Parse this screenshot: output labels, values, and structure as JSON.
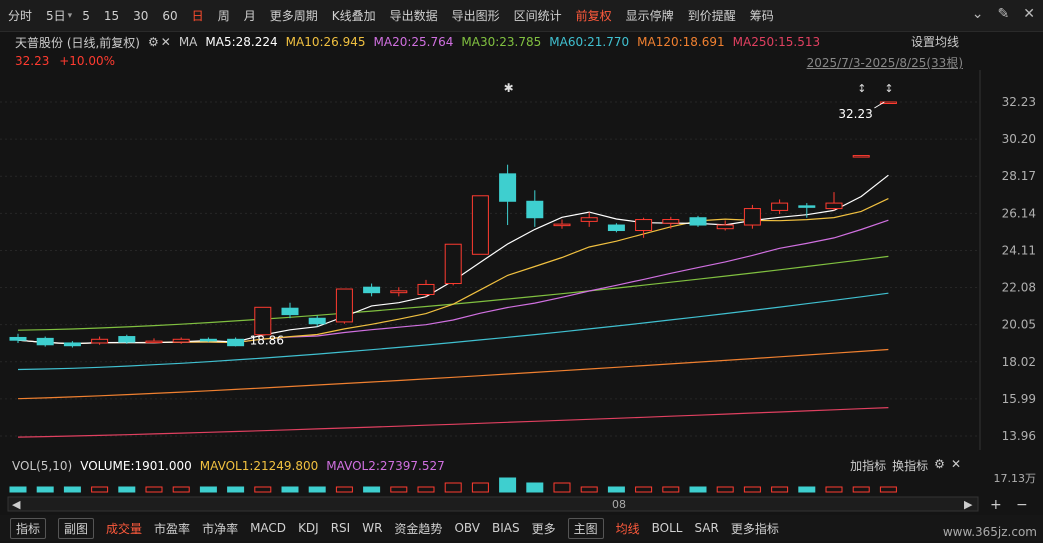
{
  "toolbar": {
    "items": [
      "分时",
      "5日",
      "5",
      "15",
      "30",
      "60",
      "日",
      "周",
      "月",
      "更多周期",
      "K线叠加",
      "导出数据",
      "导出图形",
      "区间统计",
      "前复权",
      "显示停牌",
      "到价提醒",
      "筹码"
    ]
  },
  "info": {
    "name": "天普股份 (日线,前复权)",
    "ma_label": "MA",
    "ma5": "MA5:28.224",
    "ma10": "MA10:26.945",
    "ma20": "MA20:25.764",
    "ma30": "MA30:23.785",
    "ma60": "MA60:21.770",
    "ma120": "MA120:18.691",
    "ma250": "MA250:15.513",
    "setup": "设置均线"
  },
  "price": {
    "value": "32.23",
    "change": "+10.00%"
  },
  "date_range": "2025/7/3-2025/8/25(33根)",
  "chart_data": {
    "type": "candlestick",
    "y_ticks": [
      "32.23",
      "30.20",
      "28.17",
      "26.14",
      "24.11",
      "22.08",
      "20.05",
      "18.02",
      "15.99",
      "13.96"
    ],
    "annotations": {
      "high": "32.23",
      "low": "18.86"
    },
    "x_label": "08",
    "candles": [
      {
        "o": 19.35,
        "c": 19.2,
        "h": 19.55,
        "l": 19.05
      },
      {
        "o": 19.3,
        "c": 18.95,
        "h": 19.4,
        "l": 18.85
      },
      {
        "o": 19.05,
        "c": 18.9,
        "h": 19.15,
        "l": 18.8
      },
      {
        "o": 19.05,
        "c": 19.25,
        "h": 19.4,
        "l": 18.95
      },
      {
        "o": 19.4,
        "c": 19.1,
        "h": 19.5,
        "l": 19.0
      },
      {
        "o": 19.15,
        "c": 19.15,
        "h": 19.3,
        "l": 19.05
      },
      {
        "o": 19.1,
        "c": 19.25,
        "h": 19.35,
        "l": 19.0
      },
      {
        "o": 19.25,
        "c": 19.2,
        "h": 19.35,
        "l": 19.1
      },
      {
        "o": 19.25,
        "c": 18.9,
        "h": 19.35,
        "l": 18.86
      },
      {
        "o": 19.5,
        "c": 21.0,
        "h": 21.0,
        "l": 19.4
      },
      {
        "o": 20.95,
        "c": 20.6,
        "h": 21.25,
        "l": 20.4
      },
      {
        "o": 20.4,
        "c": 20.1,
        "h": 20.55,
        "l": 19.95
      },
      {
        "o": 20.2,
        "c": 22.0,
        "h": 22.0,
        "l": 20.1
      },
      {
        "o": 22.1,
        "c": 21.8,
        "h": 22.3,
        "l": 21.6
      },
      {
        "o": 21.8,
        "c": 21.9,
        "h": 22.1,
        "l": 21.6
      },
      {
        "o": 21.7,
        "c": 22.25,
        "h": 22.5,
        "l": 21.6
      },
      {
        "o": 22.3,
        "c": 24.45,
        "h": 24.45,
        "l": 22.2
      },
      {
        "o": 23.9,
        "c": 27.1,
        "h": 27.1,
        "l": 23.9
      },
      {
        "o": 28.3,
        "c": 26.8,
        "h": 28.8,
        "l": 25.5
      },
      {
        "o": 26.8,
        "c": 25.9,
        "h": 27.4,
        "l": 25.4
      },
      {
        "o": 25.5,
        "c": 25.55,
        "h": 25.8,
        "l": 25.3
      },
      {
        "o": 25.7,
        "c": 25.9,
        "h": 26.2,
        "l": 25.4
      },
      {
        "o": 25.5,
        "c": 25.2,
        "h": 25.6,
        "l": 25.1
      },
      {
        "o": 25.2,
        "c": 25.8,
        "h": 25.9,
        "l": 24.8
      },
      {
        "o": 25.6,
        "c": 25.8,
        "h": 25.95,
        "l": 25.3
      },
      {
        "o": 25.9,
        "c": 25.5,
        "h": 26.0,
        "l": 25.4
      },
      {
        "o": 25.3,
        "c": 25.5,
        "h": 25.75,
        "l": 25.2
      },
      {
        "o": 25.5,
        "c": 26.4,
        "h": 26.6,
        "l": 25.3
      },
      {
        "o": 26.3,
        "c": 26.7,
        "h": 26.9,
        "l": 26.1
      },
      {
        "o": 26.55,
        "c": 26.5,
        "h": 26.7,
        "l": 25.9
      },
      {
        "o": 26.4,
        "c": 26.7,
        "h": 27.3,
        "l": 26.3
      },
      {
        "o": 29.3,
        "c": 29.3,
        "h": 29.3,
        "l": 29.3
      },
      {
        "o": 32.23,
        "c": 32.23,
        "h": 32.23,
        "l": 32.23
      }
    ],
    "ma_colors": {
      "ma5": "#ffffff",
      "ma10": "#f0c040",
      "ma20": "#d070e0",
      "ma30": "#80c040",
      "ma60": "#40c0d0",
      "ma120": "#f08030",
      "ma250": "#e04060"
    },
    "up_color": "#ff3b30",
    "down_color": "#3ecfcf"
  },
  "volume": {
    "label": "VOL(5,10)",
    "volume": "VOLUME:1901.000",
    "mavol1": "MAVOL1:21249.800",
    "mavol2": "MAVOL2:27397.527",
    "right_labels": [
      "加指标",
      "换指标"
    ],
    "axis_label": "17.13万"
  },
  "bottom": {
    "items": [
      "指标",
      "副图",
      "成交量",
      "市盈率",
      "市净率",
      "MACD",
      "KDJ",
      "RSI",
      "WR",
      "资金趋势",
      "OBV",
      "BIAS",
      "更多",
      "主图",
      "均线",
      "BOLL",
      "SAR",
      "更多指标"
    ]
  },
  "watermark": "www.365jz.com"
}
